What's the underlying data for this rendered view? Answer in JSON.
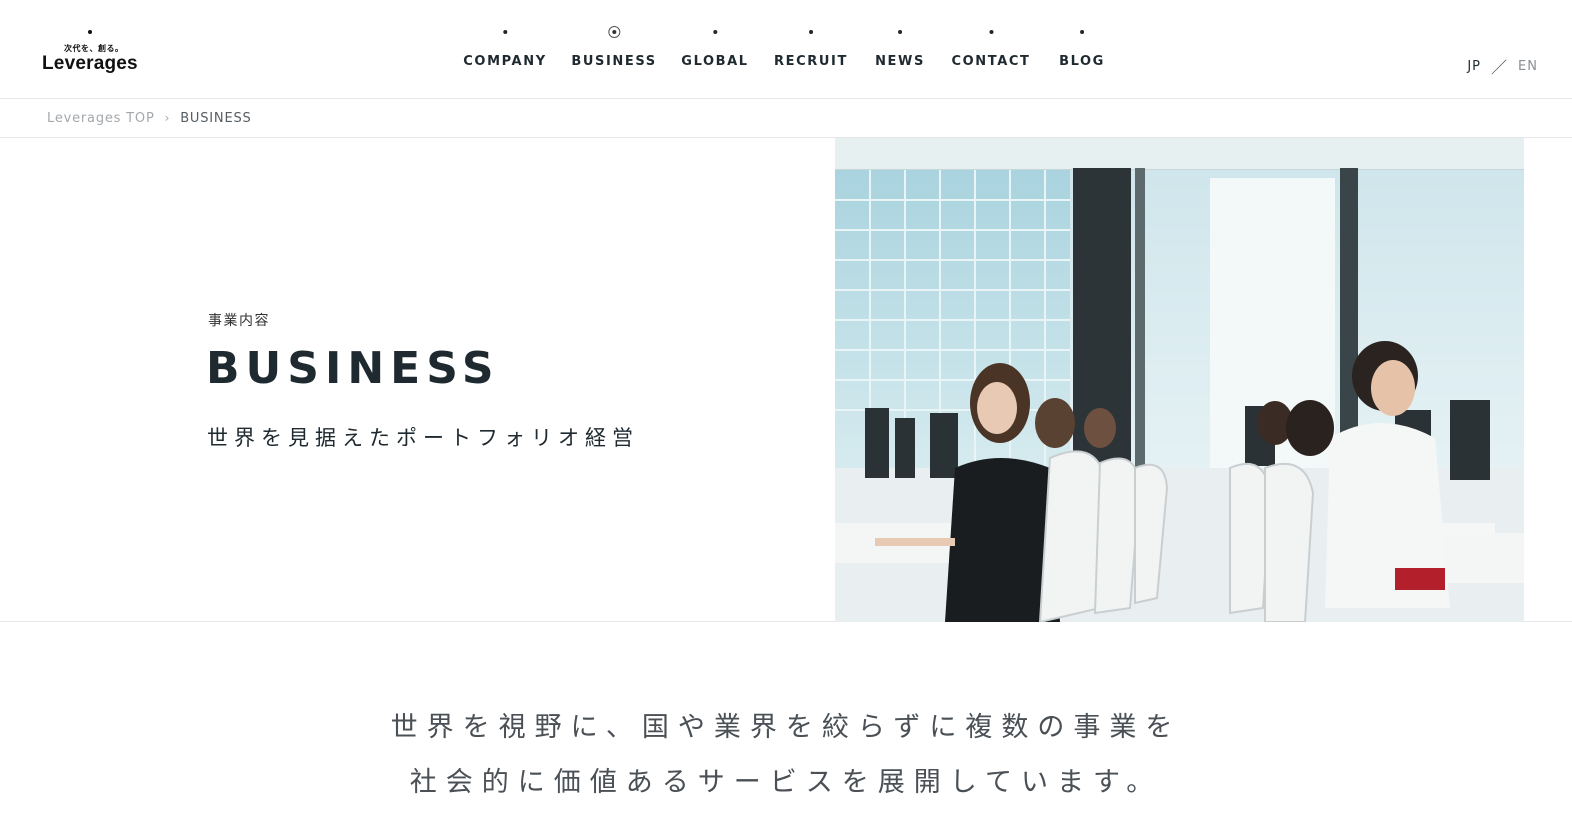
{
  "header": {
    "logo": {
      "tagline": "次代を、創る。",
      "wordmark": "Leverages"
    },
    "nav": [
      {
        "label": "COMPANY",
        "active": false
      },
      {
        "label": "BUSINESS",
        "active": true
      },
      {
        "label": "GLOBAL",
        "active": false
      },
      {
        "label": "RECRUIT",
        "active": false
      },
      {
        "label": "NEWS",
        "active": false
      },
      {
        "label": "CONTACT",
        "active": false
      },
      {
        "label": "BLOG",
        "active": false
      }
    ],
    "lang": {
      "jp": "JP",
      "separator": "／",
      "en": "EN"
    }
  },
  "breadcrumb": {
    "home": "Leverages TOP",
    "separator": "›",
    "current": "BUSINESS"
  },
  "hero": {
    "subtitle": "事業内容",
    "title": "BUSINESS",
    "tagline": "世界を見据えたポートフォリオ経営"
  },
  "statement": {
    "line1": "世界を視野に、国や業界を絞らずに複数の事業を",
    "line2": "社会的に価値あるサービスを展開しています。"
  },
  "colors": {
    "text": "#1f2a30",
    "muted": "#a3a8ad",
    "border": "#e4e6e8",
    "statement": "#4a5055"
  }
}
